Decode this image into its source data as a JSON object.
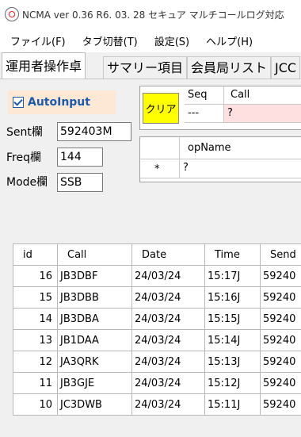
{
  "window": {
    "title": "NCMA ver 0.36  R6. 03. 28   セキュア マルチコールログ対応"
  },
  "menu": [
    "ファイル(F)",
    "タブ切替(T)",
    "設定(S)",
    "ヘルプ(H)"
  ],
  "tabs": [
    "運用者操作卓",
    "サマリー項目",
    "会員局リスト",
    "JCC"
  ],
  "form": {
    "autoinput_label": "AutoInput",
    "autoinput_checked": true,
    "sent_label": "Sent欄",
    "sent_value": "592403M",
    "freq_label": "Freq欄",
    "freq_value": "144",
    "mode_label": "Mode欄",
    "mode_value": "SSB"
  },
  "seq_grid": {
    "clear_label": "クリア",
    "headers": [
      "Seq",
      "Call"
    ],
    "row": [
      "---",
      "?"
    ]
  },
  "op_grid": {
    "header": "opName",
    "row_marker": "*",
    "row_value": "?"
  },
  "log": {
    "columns": [
      "id",
      "Call",
      "Date",
      "Time",
      "Send"
    ],
    "rows": [
      {
        "id": "16",
        "call": "JB3DBF",
        "date": "24/03/24",
        "time": "15:17J",
        "send": "59240"
      },
      {
        "id": "15",
        "call": "JB3DBB",
        "date": "24/03/24",
        "time": "15:16J",
        "send": "59240"
      },
      {
        "id": "14",
        "call": "JB3DBA",
        "date": "24/03/24",
        "time": "15:15J",
        "send": "59240"
      },
      {
        "id": "13",
        "call": "JB1DAA",
        "date": "24/03/24",
        "time": "15:14J",
        "send": "59240"
      },
      {
        "id": "12",
        "call": "JA3QRK",
        "date": "24/03/24",
        "time": "15:13J",
        "send": "59240"
      },
      {
        "id": "11",
        "call": "JB3GJE",
        "date": "24/03/24",
        "time": "15:12J",
        "send": "59240"
      },
      {
        "id": "10",
        "call": "JC3DWB",
        "date": "24/03/24",
        "time": "15:11J",
        "send": "59240"
      }
    ]
  },
  "colors": {
    "clear_button": "#ffff00",
    "autoinput_bg": "#fde8d6",
    "call_cell_bg": "#ffe0e0"
  }
}
